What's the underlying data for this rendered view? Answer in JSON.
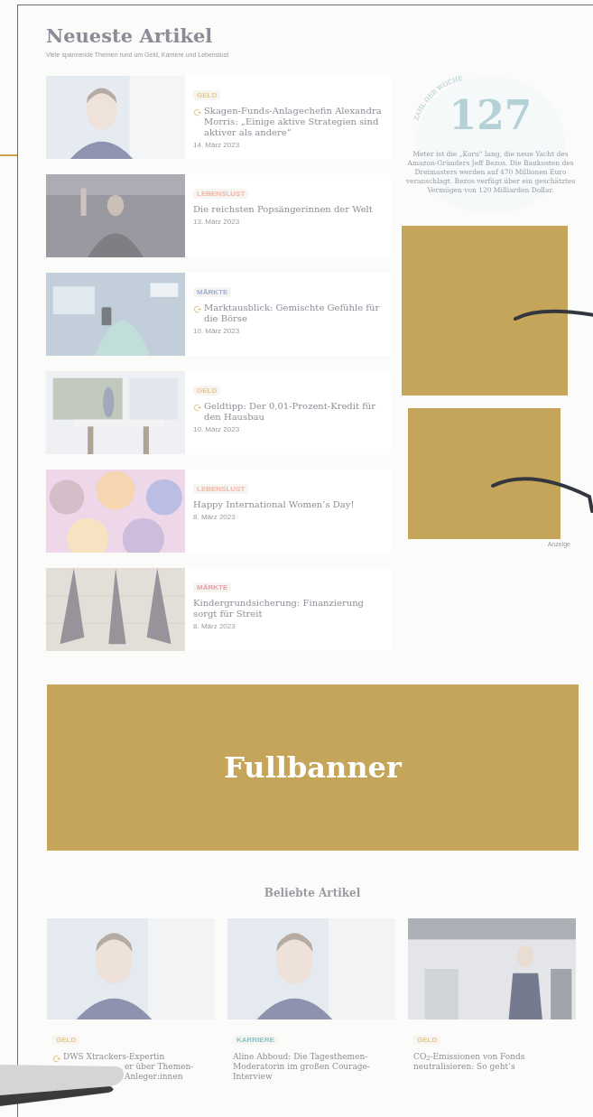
{
  "latest": {
    "title": "Neueste Artikel",
    "subtitle": "Viele spannende Themen rund um Geld, Karriere und Lebenslust",
    "articles": [
      {
        "tag": "GELD",
        "color": "#e8c98a",
        "premium": true,
        "title": "Skagen-Funds-Anlagechefin Alexandra Morris: „Einige aktive Strategien sind aktiver als andere“",
        "date": "14. März 2023"
      },
      {
        "tag": "LEBENSLUST",
        "color": "#f2b8a8",
        "premium": false,
        "title": "Die reichsten Popsängerinnen der Welt",
        "date": "13. März 2023"
      },
      {
        "tag": "MÄRKTE",
        "color": "#9fb0d6",
        "premium": true,
        "title": "Marktausblick: Gemischte Gefühle für die Börse",
        "date": "10. März 2023"
      },
      {
        "tag": "GELD",
        "color": "#e8c98a",
        "premium": true,
        "title": "Geldtipp: Der 0,01-Prozent-Kredit für den Hausbau",
        "date": "10. März 2023"
      },
      {
        "tag": "LEBENSLUST",
        "color": "#f2b8a8",
        "premium": false,
        "title": "Happy International Women’s Day!",
        "date": "8. März 2023"
      },
      {
        "tag": "MÄRKTE",
        "color": "#e6a0a8",
        "premium": false,
        "title": "Kindergrundsicherung: Finanzierung sorgt für Streit",
        "date": "8. März 2023"
      }
    ]
  },
  "number_of_week": {
    "label": "ZAHL DER WOCHE",
    "number": "127",
    "text": "Meter ist die „Koru“ lang, die neue Yacht des Amazon-Gründers Jeff Bezos. Die Baukosten des Dreimasters werden auf 470 Millionen Euro veranschlagt. Bezos verfügt über ein geschätztes Vermögen von 120 Milliarden Dollar."
  },
  "ad_label": "Anzeige",
  "fullbanner": "Fullbanner",
  "popular": {
    "title": "Beliebte Artikel",
    "cards": [
      {
        "tag": "GELD",
        "color": "#e8c98a",
        "premium": true,
        "fragments": [
          {
            "kind": "line",
            "text": "DWS Xtrackers-Expertin"
          },
          {
            "kind": "after_cover",
            "text": "er über Themen-"
          },
          {
            "kind": "after_cover",
            "text": "Anleger:innen"
          }
        ]
      },
      {
        "tag": "KARRIERE",
        "color": "#8fc3c8",
        "premium": false,
        "lines": [
          "Aline Abboud: Die Tagesthemen-",
          "Moderatorin im großen Courage-",
          "Interview"
        ]
      },
      {
        "tag": "GELD",
        "color": "#e8c98a",
        "premium": false,
        "lines": [
          "CO$_{2}$-Emissionen von Fonds",
          "neutralisieren: So geht‘s"
        ]
      }
    ]
  }
}
